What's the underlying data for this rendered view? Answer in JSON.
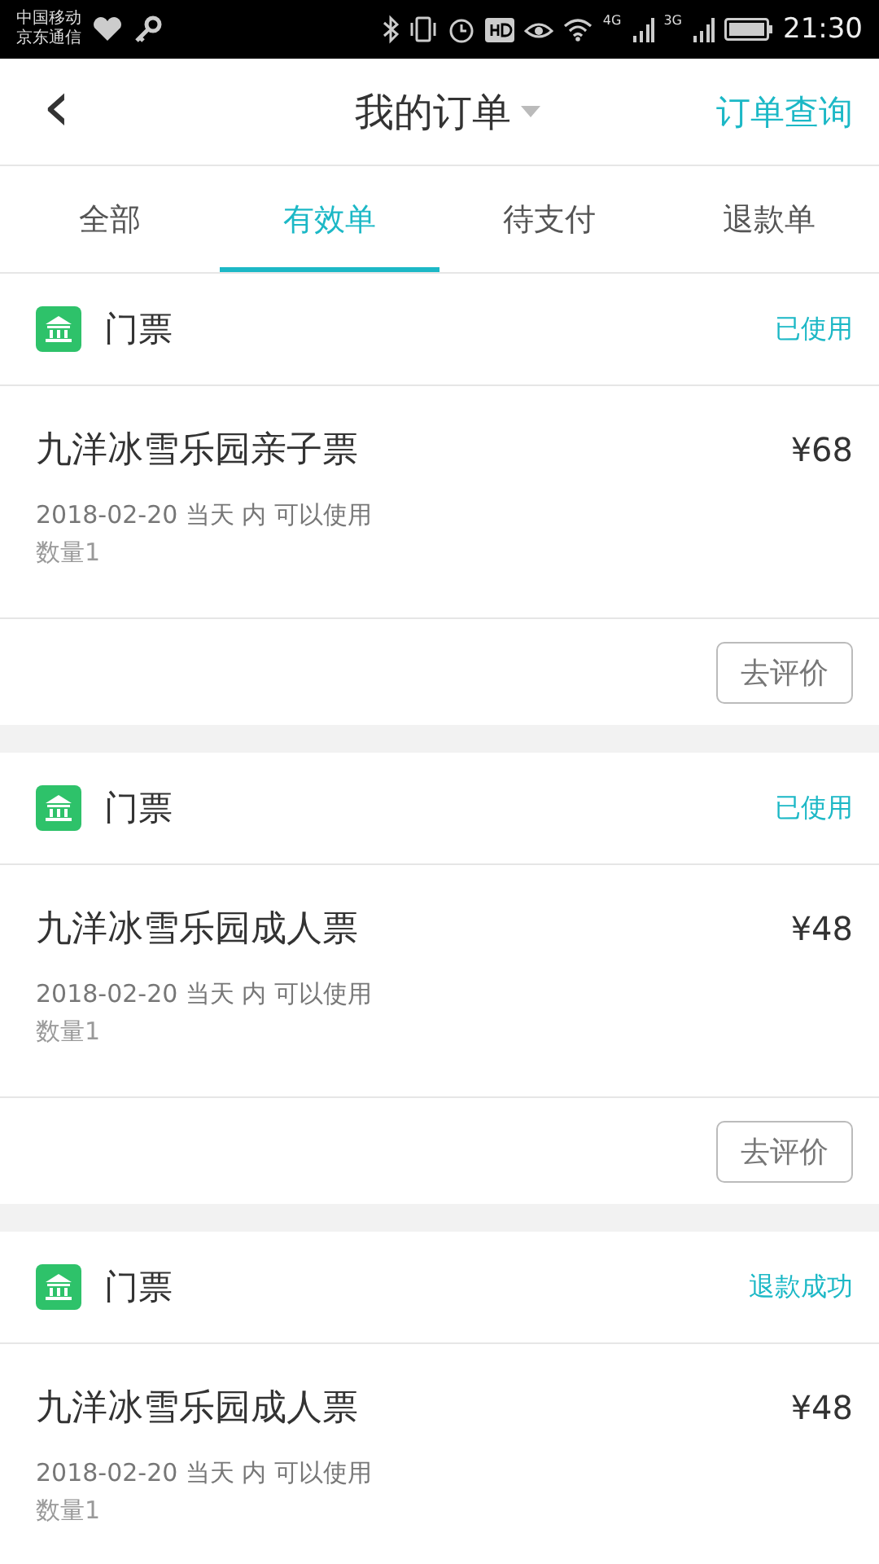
{
  "status_bar": {
    "carriers": [
      "中国移动",
      "京东通信"
    ],
    "network_labels": [
      "4G",
      "3G"
    ],
    "time": "21:30"
  },
  "header": {
    "back": "‹",
    "title": "我的订单",
    "action": "订单查询"
  },
  "tabs": [
    {
      "label": "全部",
      "selected": false
    },
    {
      "label": "有效单",
      "selected": true
    },
    {
      "label": "待支付",
      "selected": false
    },
    {
      "label": "退款单",
      "selected": false
    }
  ],
  "orders": [
    {
      "category": "门票",
      "status": "已使用",
      "name": "九洋冰雪乐园亲子票",
      "price": "¥68",
      "validity": "2018-02-20 当天 内 可以使用",
      "quantity": "数量1",
      "review_button": "去评价"
    },
    {
      "category": "门票",
      "status": "已使用",
      "name": "九洋冰雪乐园成人票",
      "price": "¥48",
      "validity": "2018-02-20 当天 内 可以使用",
      "quantity": "数量1",
      "review_button": "去评价"
    },
    {
      "category": "门票",
      "status": "退款成功",
      "name": "九洋冰雪乐园成人票",
      "price": "¥48",
      "validity": "2018-02-20 当天 内 可以使用",
      "quantity": "数量1"
    }
  ]
}
